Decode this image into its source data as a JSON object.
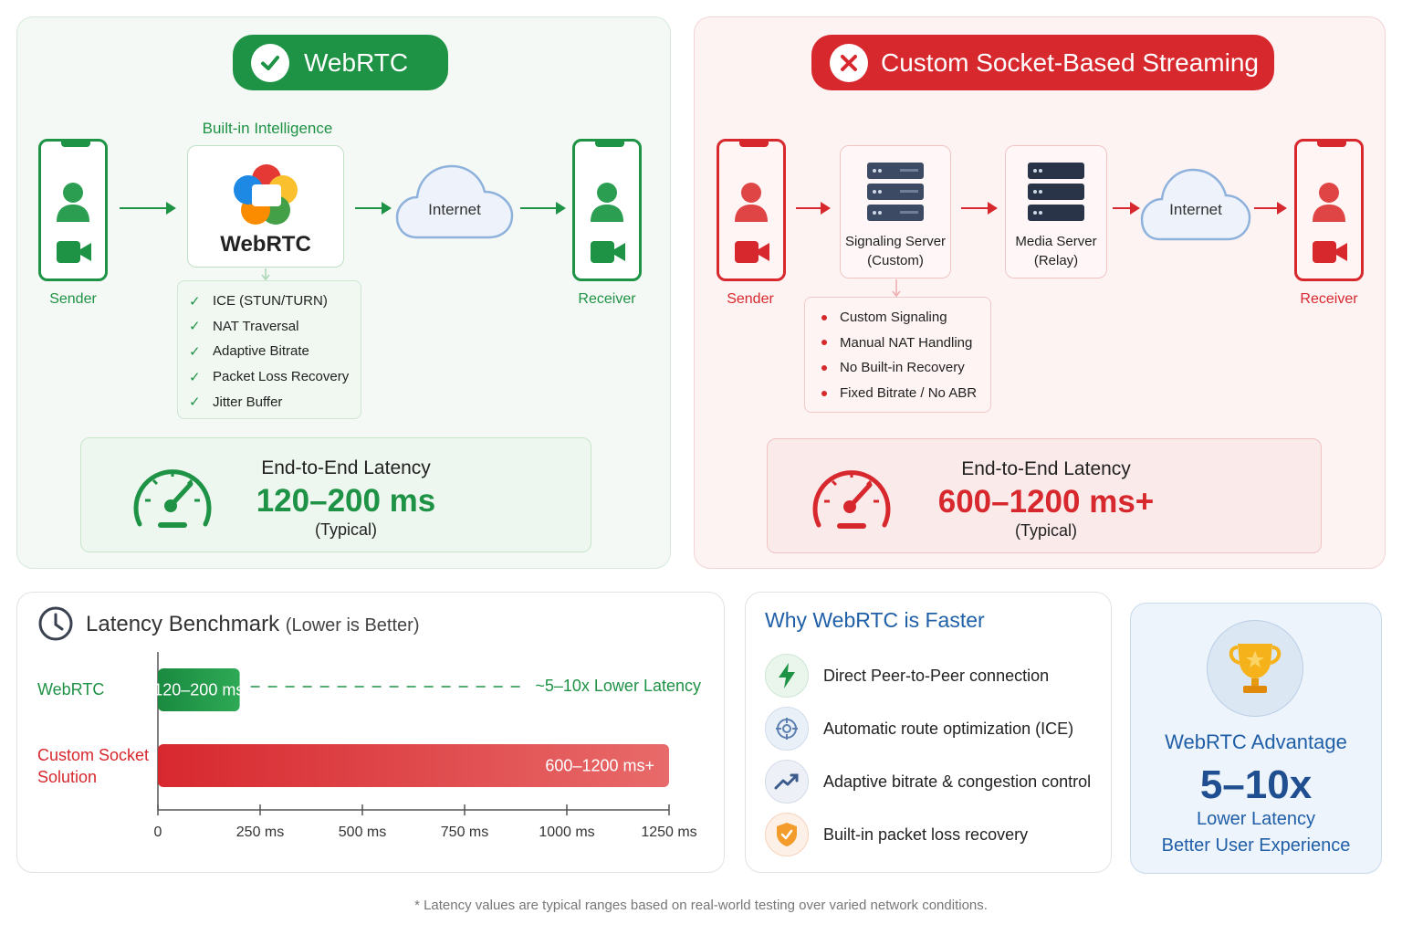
{
  "webrtc": {
    "title": "WebRTC",
    "builtin_label": "Built-in Intelligence",
    "logo_text": "WebRTC",
    "internet_label": "Internet",
    "sender_label": "Sender",
    "receiver_label": "Receiver",
    "features": [
      "ICE (STUN/TURN)",
      "NAT Traversal",
      "Adaptive Bitrate",
      "Packet Loss Recovery",
      "Jitter Buffer"
    ],
    "latency_title": "End-to-End Latency",
    "latency_value": "120–200 ms",
    "latency_sub": "(Typical)"
  },
  "custom": {
    "title": "Custom Socket-Based Streaming",
    "signaling_line1": "Signaling Server",
    "signaling_line2": "(Custom)",
    "media_line1": "Media Server",
    "media_line2": "(Relay)",
    "internet_label": "Internet",
    "sender_label": "Sender",
    "receiver_label": "Receiver",
    "features": [
      "Custom Signaling",
      "Manual NAT Handling",
      "No Built-in Recovery",
      "Fixed Bitrate / No ABR"
    ],
    "latency_title": "End-to-End Latency",
    "latency_value": "600–1200 ms+",
    "latency_sub": "(Typical)"
  },
  "benchmark": {
    "title": "Latency Benchmark",
    "title_suffix": "(Lower is Better)",
    "comparison_label": "~5–10x Lower Latency"
  },
  "chart_data": {
    "type": "bar",
    "orientation": "horizontal",
    "categories": [
      "WebRTC",
      "Custom Socket Solution"
    ],
    "ranges": [
      [
        120,
        200
      ],
      [
        600,
        1200
      ]
    ],
    "values": [
      200,
      1250
    ],
    "data_labels": [
      "120–200 ms",
      "600–1200 ms+"
    ],
    "x_ticks": [
      "0",
      "250 ms",
      "500 ms",
      "750 ms",
      "1000 ms",
      "1250 ms"
    ],
    "xlim": [
      0,
      1250
    ],
    "colors": [
      "#1e9245",
      "#d7282e"
    ]
  },
  "why": {
    "title": "Why WebRTC is Faster",
    "items": [
      {
        "label": "Direct Peer-to-Peer connection",
        "icon": "lightning-icon"
      },
      {
        "label": "Automatic route optimization (ICE)",
        "icon": "network-icon"
      },
      {
        "label": "Adaptive bitrate & congestion control",
        "icon": "trend-up-icon"
      },
      {
        "label": "Built-in packet loss recovery",
        "icon": "shield-check-icon"
      }
    ]
  },
  "advantage": {
    "title": "WebRTC Advantage",
    "value": "5–10x",
    "line1": "Lower Latency",
    "line2": "Better User Experience"
  },
  "footnote": "* Latency values are typical ranges based on real-world testing over varied network conditions.",
  "colors": {
    "green": "#1e9245",
    "red": "#d7282e",
    "blue": "#1f5fa8"
  }
}
